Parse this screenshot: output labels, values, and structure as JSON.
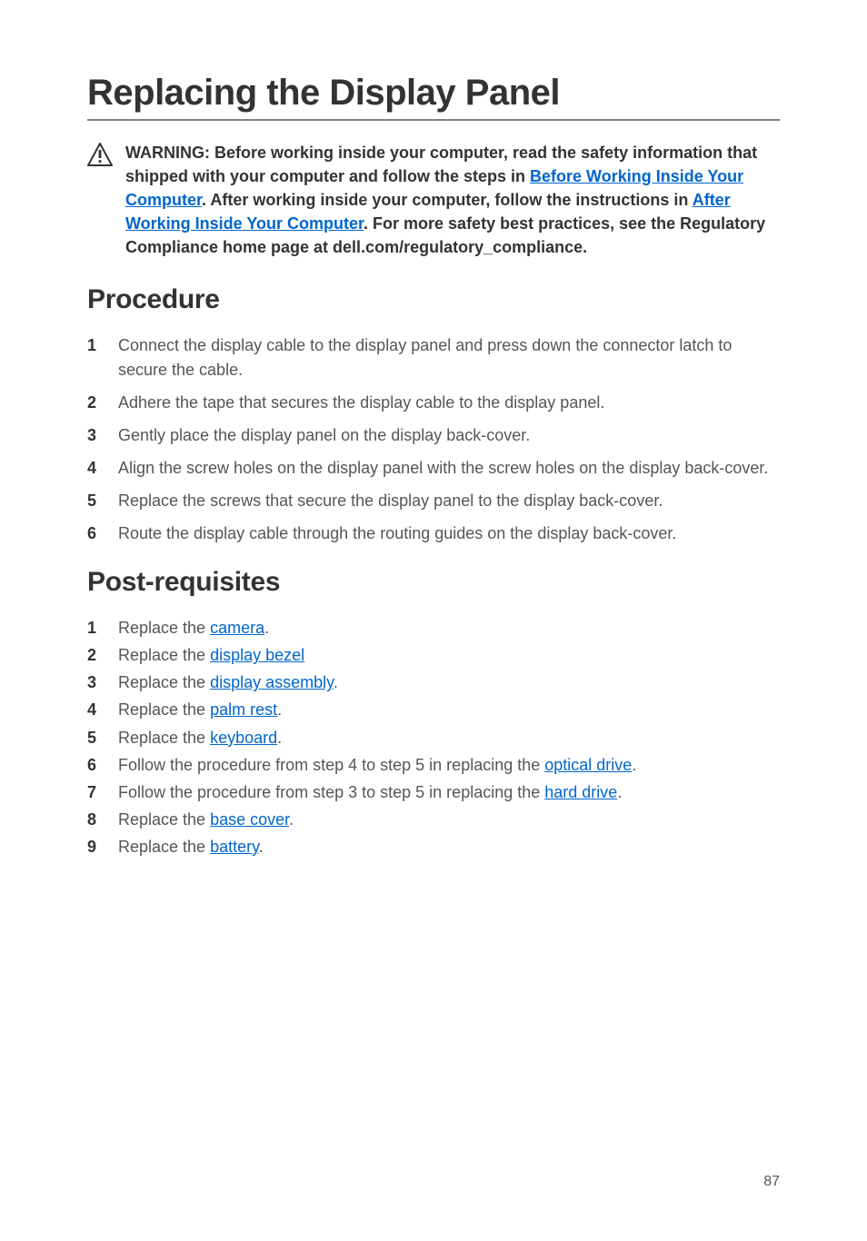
{
  "title": "Replacing the Display Panel",
  "warning": {
    "pre": "WARNING: Before working inside your computer, read the safety information that shipped with your computer and follow the steps in ",
    "link1": "Before Working Inside Your Computer",
    "mid1": ". After working inside your computer, follow the instructions in ",
    "link2": "After Working Inside Your Computer",
    "post": ". For more safety best practices, see the Regulatory Compliance home page at dell.com/regulatory_compliance."
  },
  "sections": {
    "procedure": {
      "heading": "Procedure",
      "steps": [
        "Connect the display cable to the display panel and press down the connector latch to secure the cable.",
        "Adhere the tape that secures the display cable to the display panel.",
        "Gently place the display panel on the display back-cover.",
        "Align the screw holes on the display panel with the screw holes on the display back-cover.",
        "Replace the screws that secure the display panel to the display back-cover.",
        "Route the display cable through the routing guides on the display back-cover."
      ]
    },
    "post_requisites": {
      "heading": "Post-requisites",
      "items": [
        {
          "pre": "Replace the ",
          "link": "camera",
          "post": "."
        },
        {
          "pre": "Replace the ",
          "link": "display bezel",
          "post": ""
        },
        {
          "pre": "Replace the ",
          "link": "display assembly",
          "post": "."
        },
        {
          "pre": "Replace the ",
          "link": "palm rest",
          "post": "."
        },
        {
          "pre": "Replace the ",
          "link": "keyboard",
          "post": "."
        },
        {
          "pre": "Follow the procedure from step 4 to step 5 in replacing the ",
          "link": "optical drive",
          "post": "."
        },
        {
          "pre": "Follow the procedure from step 3 to step 5 in replacing the ",
          "link": "hard drive",
          "post": "."
        },
        {
          "pre": "Replace the ",
          "link": "base cover",
          "post": "."
        },
        {
          "pre": "Replace the ",
          "link": "battery",
          "post": "."
        }
      ]
    }
  },
  "page_number": "87"
}
